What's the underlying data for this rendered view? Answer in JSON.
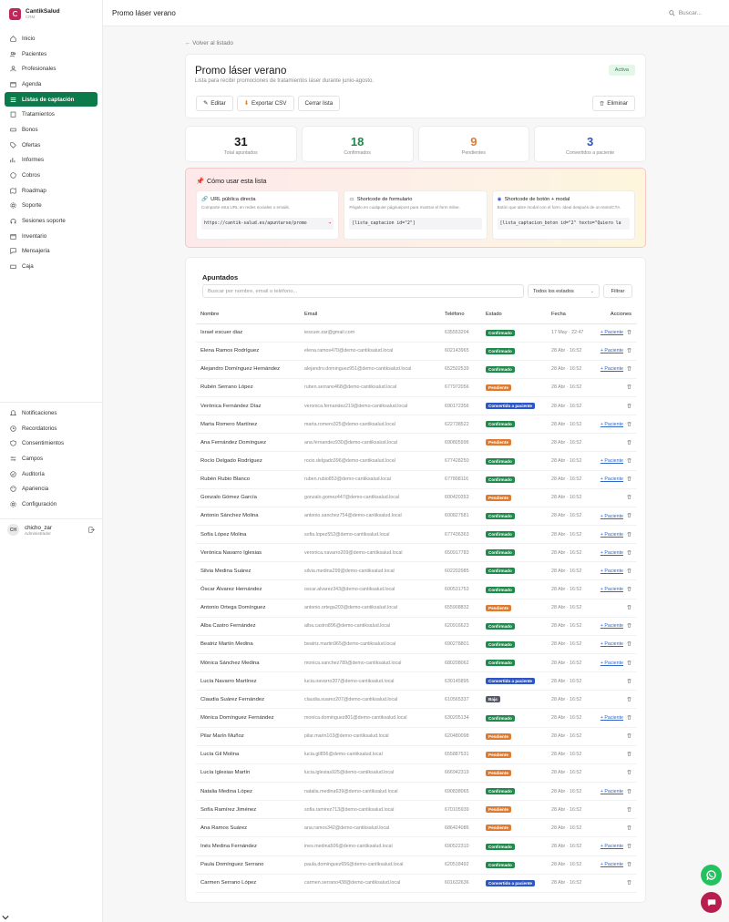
{
  "brand": {
    "name": "CantikSalud",
    "sub": "CRM"
  },
  "nav": [
    {
      "label": "Inicio",
      "icon": "home-icon"
    },
    {
      "label": "Pacientes",
      "icon": "users-icon"
    },
    {
      "label": "Profesionales",
      "icon": "user-icon"
    },
    {
      "label": "Agenda",
      "icon": "calendar-icon"
    },
    {
      "label": "Listas de captación",
      "icon": "list-icon",
      "active": true
    },
    {
      "label": "Tratamientos",
      "icon": "clipboard-icon"
    },
    {
      "label": "Bonos",
      "icon": "ticket-icon"
    },
    {
      "label": "Ofertas",
      "icon": "tag-icon"
    },
    {
      "label": "Informes",
      "icon": "chart-icon"
    },
    {
      "label": "Cobros",
      "icon": "coin-icon"
    },
    {
      "label": "Roadmap",
      "icon": "map-icon"
    },
    {
      "label": "Soporte",
      "icon": "gear-icon"
    },
    {
      "label": "Sesiones soporte",
      "icon": "headset-icon"
    },
    {
      "label": "Inventario",
      "icon": "box-icon"
    },
    {
      "label": "Mensajería",
      "icon": "message-icon"
    },
    {
      "label": "Caja",
      "icon": "cashbox-icon"
    }
  ],
  "nav_bottom": [
    {
      "label": "Notificaciones",
      "icon": "bell-icon"
    },
    {
      "label": "Recordatorios",
      "icon": "clock-icon"
    },
    {
      "label": "Consentimientos",
      "icon": "shield-icon"
    },
    {
      "label": "Campos",
      "icon": "sliders-icon"
    },
    {
      "label": "Auditoría",
      "icon": "audit-icon"
    },
    {
      "label": "Apariencia",
      "icon": "palette-icon"
    },
    {
      "label": "Configuración",
      "icon": "settings-icon"
    }
  ],
  "user": {
    "initials": "CH",
    "name": "chicho_zar",
    "role": "Administrador"
  },
  "topbar": {
    "title": "Promo láser verano",
    "search": "Buscar..."
  },
  "back": "← Volver al listado",
  "header": {
    "title": "Promo láser verano",
    "subtitle": "Lista para recibir promociones de tratamientos láser durante junio-agosto.",
    "status": "Activa",
    "edit": "Editar",
    "export": "Exportar CSV",
    "close": "Cerrar lista",
    "delete": "Eliminar"
  },
  "stats": [
    {
      "value": "31",
      "label": "Total apuntados",
      "color": "#1a1a1a"
    },
    {
      "value": "18",
      "label": "Confirmados",
      "color": "#1f8a4c"
    },
    {
      "value": "9",
      "label": "Pendientes",
      "color": "#e07a2f"
    },
    {
      "value": "3",
      "label": "Convertidos a paciente",
      "color": "#2e55c4"
    }
  ],
  "howto": {
    "title": "Cómo usar esta lista",
    "boxes": [
      {
        "title": "URL pública directa",
        "desc": "Comparte esta URL en redes sociales o emails.",
        "code": "https://cantik-salud.es/apuntarse/promo",
        "copy": "→"
      },
      {
        "title": "Shortcode de formulario",
        "desc": "Pégalo en cualquier página/post para mostrar el form inline.",
        "code": "[lista_captacion id=\"2\"]",
        "copy": ""
      },
      {
        "title": "Shortcode de botón + modal",
        "desc": "Botón que abre modal con el form. Ideal después de un texto/CTA.",
        "code": "[lista_captacion_boton id=\"2\" texto=\"Quiero la",
        "copy": ""
      }
    ]
  },
  "list": {
    "title": "Apuntados",
    "search_placeholder": "Buscar por nombre, email o teléfono...",
    "status_filter": "Todos los estados",
    "filter_btn": "Filtrar",
    "columns": [
      "Nombre",
      "Email",
      "Teléfono",
      "Estado",
      "Fecha",
      "Acciones"
    ],
    "add_patient": "+ Paciente"
  },
  "status_colors": {
    "Confirmado": "#1f8a4c",
    "Pendiente": "#e07a2f",
    "Convertido a paciente": "#2e55c4",
    "Baja": "#555c66"
  },
  "rows": [
    [
      "Israel escuer diaz",
      "iescuer.zar@gmail.com",
      "635553204",
      "Confirmado",
      "17 May · 22:47",
      true
    ],
    [
      "Elena Ramos Rodríguez",
      "elena.ramos470@demo-cantiksalud.local",
      "602143965",
      "Confirmado",
      "28 Abr · 16:52",
      true
    ],
    [
      "Alejandro Domínguez Hernández",
      "alejandro.dominguez951@demo-cantiksalud.local",
      "652502539",
      "Confirmado",
      "28 Abr · 16:52",
      true
    ],
    [
      "Rubén Serrano López",
      "ruben.serrano468@demo-cantiksalud.local",
      "677972056",
      "Pendiente",
      "28 Abr · 16:52",
      false
    ],
    [
      "Verónica Fernández Díaz",
      "veronica.fernandez219@demo-cantiksalud.local",
      "690172356",
      "Convertido a paciente",
      "28 Abr · 16:52",
      false
    ],
    [
      "Marta Romero Martínez",
      "marta.romero325@demo-cantiksalud.local",
      "622738522",
      "Confirmado",
      "28 Abr · 16:52",
      true
    ],
    [
      "Ana Fernández Domínguez",
      "ana.fernandez930@demo-cantiksalud.local",
      "690805996",
      "Pendiente",
      "28 Abr · 16:52",
      false
    ],
    [
      "Rocío Delgado Rodríguez",
      "rocio.delgado396@demo-cantiksalud.local",
      "677428250",
      "Confirmado",
      "28 Abr · 16:52",
      true
    ],
    [
      "Rubén Rubio Blanco",
      "ruben.rubio853@demo-cantiksalud.local",
      "677808116",
      "Confirmado",
      "28 Abr · 16:52",
      true
    ],
    [
      "Gonzalo Gómez García",
      "gonzalo.gomez447@demo-cantiksalud.local",
      "600420353",
      "Pendiente",
      "28 Abr · 16:52",
      false
    ],
    [
      "Antonio Sánchez Molina",
      "antonio.sanchez754@demo-cantiksalud.local",
      "600827581",
      "Confirmado",
      "28 Abr · 16:52",
      true
    ],
    [
      "Sofía López Molina",
      "sofia.lopez552@demo-cantiksalud.local",
      "677436363",
      "Confirmado",
      "28 Abr · 16:52",
      true
    ],
    [
      "Verónica Navarro Iglesias",
      "veronica.navarro209@demo-cantiksalud.local",
      "650917783",
      "Confirmado",
      "28 Abr · 16:52",
      true
    ],
    [
      "Silvia Medina Suárez",
      "silvia.medina299@demo-cantiksalud.local",
      "602202985",
      "Confirmado",
      "28 Abr · 16:52",
      true
    ],
    [
      "Óscar Álvarez Hernández",
      "oscar.alvarez343@demo-cantiksalud.local",
      "600531753",
      "Confirmado",
      "28 Abr · 16:52",
      true
    ],
    [
      "Antonio Ortega Domínguez",
      "antonio.ortega203@demo-cantiksalud.local",
      "655908832",
      "Pendiente",
      "28 Abr · 16:52",
      false
    ],
    [
      "Alba Castro Fernández",
      "alba.castro896@demo-cantiksalud.local",
      "620916623",
      "Confirmado",
      "28 Abr · 16:52",
      true
    ],
    [
      "Beatriz Martín Medina",
      "beatriz.martin965@demo-cantiksalud.local",
      "690278801",
      "Confirmado",
      "28 Abr · 16:52",
      true
    ],
    [
      "Mónica Sánchez Medina",
      "monica.sanchez789@demo-cantiksalud.local",
      "680208062",
      "Confirmado",
      "28 Abr · 16:52",
      true
    ],
    [
      "Lucía Navarro Martínez",
      "lucia.navarro207@demo-cantiksalud.local",
      "630145895",
      "Convertido a paciente",
      "28 Abr · 16:52",
      false
    ],
    [
      "Claudia Suárez Fernández",
      "claudia.suarez207@demo-cantiksalud.local",
      "610565337",
      "Baja",
      "28 Abr · 16:52",
      false
    ],
    [
      "Mónica Domínguez Fernández",
      "monica.dominguez801@demo-cantiksalud.local",
      "630205134",
      "Confirmado",
      "28 Abr · 16:52",
      true
    ],
    [
      "Pilar Marín Muñoz",
      "pilar.marin103@demo-cantiksalud.local",
      "620480098",
      "Pendiente",
      "28 Abr · 16:52",
      false
    ],
    [
      "Lucía Gil Molina",
      "lucia.gil856@demo-cantiksalud.local",
      "655887531",
      "Pendiente",
      "28 Abr · 16:52",
      false
    ],
    [
      "Lucía Iglesias Martín",
      "lucia.iglesias925@demo-cantiksalud.local",
      "666942319",
      "Pendiente",
      "28 Abr · 16:52",
      false
    ],
    [
      "Natalia Medina López",
      "natalia.medina639@demo-cantiksalud.local",
      "690838065",
      "Confirmado",
      "28 Abr · 16:52",
      true
    ],
    [
      "Sofía Ramírez Jiménez",
      "sofia.ramirez713@demo-cantiksalud.local",
      "670105939",
      "Pendiente",
      "28 Abr · 16:52",
      false
    ],
    [
      "Ana Ramos Suárez",
      "ana.ramos342@demo-cantiksalud.local",
      "686424086",
      "Pendiente",
      "28 Abr · 16:52",
      false
    ],
    [
      "Inés Medina Fernández",
      "ines.medina506@demo-cantiksalud.local",
      "690522310",
      "Confirmado",
      "28 Abr · 16:52",
      true
    ],
    [
      "Paula Domínguez Serrano",
      "paula.dominguez656@demo-cantiksalud.local",
      "620518492",
      "Confirmado",
      "28 Abr · 16:52",
      true
    ],
    [
      "Carmen Serrano López",
      "carmen.serrano438@demo-cantiksalud.local",
      "601632636",
      "Convertido a paciente",
      "28 Abr · 16:52",
      false
    ]
  ]
}
